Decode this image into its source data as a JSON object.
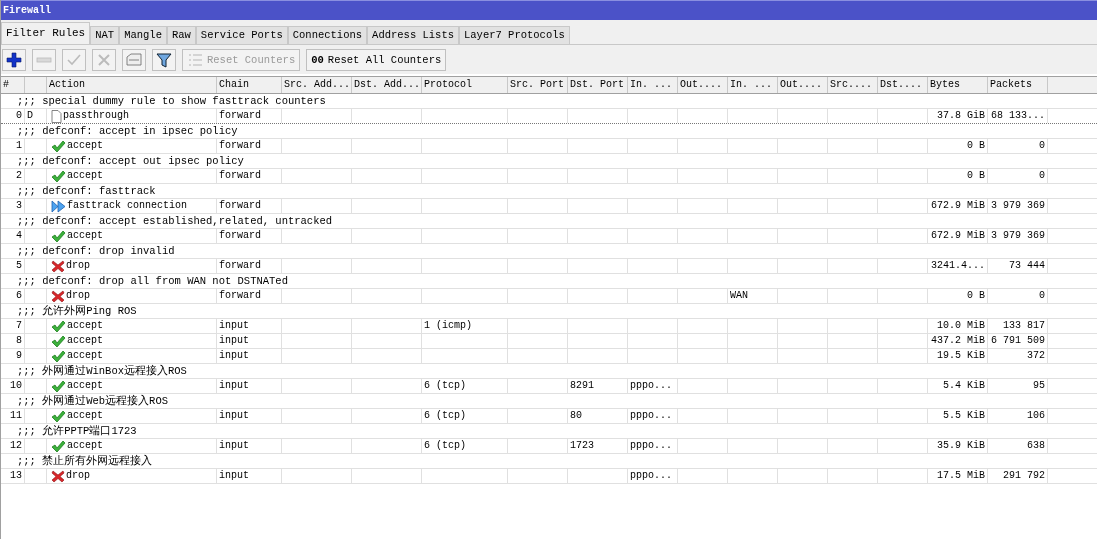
{
  "window": {
    "title": "Firewall"
  },
  "tabs": [
    {
      "label": "Filter Rules",
      "selected": true
    },
    {
      "label": "NAT",
      "selected": false
    },
    {
      "label": "Mangle",
      "selected": false
    },
    {
      "label": "Raw",
      "selected": false
    },
    {
      "label": "Service Ports",
      "selected": false
    },
    {
      "label": "Connections",
      "selected": false
    },
    {
      "label": "Address Lists",
      "selected": false
    },
    {
      "label": "Layer7 Protocols",
      "selected": false
    }
  ],
  "toolbar": [
    {
      "kind": "add",
      "disabled": false
    },
    {
      "kind": "remove",
      "disabled": true
    },
    {
      "kind": "enable",
      "disabled": true
    },
    {
      "kind": "disable",
      "disabled": true
    },
    {
      "kind": "comment",
      "disabled": false
    },
    {
      "kind": "filter",
      "disabled": false
    },
    {
      "kind": "reset",
      "label": "Reset Counters",
      "disabled": true
    },
    {
      "kind": "reset_all",
      "label": "Reset All Counters",
      "prefix": "00",
      "disabled": false
    }
  ],
  "table": {
    "columns": [
      "#",
      "",
      "Action",
      "Chain",
      "Src. Add...",
      "Dst. Add...",
      "Protocol",
      "Src. Port",
      "Dst. Port",
      "In. ...",
      "Out....",
      "In. ...",
      "Out....",
      "Src....",
      "Dst....",
      "Bytes",
      "Packets"
    ],
    "rows": [
      {
        "kind": "comment",
        "text": ";;; special dummy rule to show fasttrack counters"
      },
      {
        "kind": "rule",
        "focused": true,
        "number": "0",
        "flag": "D",
        "action": {
          "kind": "passthrough",
          "label": "passthrough"
        },
        "chain": "forward",
        "bytes": "37.8 GiB",
        "packets": "68 133..."
      },
      {
        "kind": "comment",
        "text": ";;; defconf: accept in ipsec policy"
      },
      {
        "kind": "rule",
        "focused": false,
        "number": "1",
        "action": {
          "kind": "accept",
          "label": "accept"
        },
        "chain": "forward",
        "bytes": "0 B",
        "packets": "0"
      },
      {
        "kind": "comment",
        "text": ";;; defconf: accept out ipsec policy"
      },
      {
        "kind": "rule",
        "focused": false,
        "number": "2",
        "action": {
          "kind": "accept",
          "label": "accept"
        },
        "chain": "forward",
        "bytes": "0 B",
        "packets": "0"
      },
      {
        "kind": "comment",
        "text": ";;; defconf: fasttrack"
      },
      {
        "kind": "rule",
        "focused": false,
        "number": "3",
        "action": {
          "kind": "fasttrack",
          "label": "fasttrack connection"
        },
        "chain": "forward",
        "bytes": "672.9 MiB",
        "packets": "3 979 369"
      },
      {
        "kind": "comment",
        "text": ";;; defconf: accept established,related, untracked"
      },
      {
        "kind": "rule",
        "focused": false,
        "number": "4",
        "action": {
          "kind": "accept",
          "label": "accept"
        },
        "chain": "forward",
        "bytes": "672.9 MiB",
        "packets": "3 979 369"
      },
      {
        "kind": "comment",
        "text": ";;; defconf: drop invalid"
      },
      {
        "kind": "rule",
        "focused": false,
        "number": "5",
        "action": {
          "kind": "drop",
          "label": "drop"
        },
        "chain": "forward",
        "bytes": "3241.4...",
        "packets": "73 444"
      },
      {
        "kind": "comment",
        "text": ";;; defconf:  drop all from WAN not DSTNATed"
      },
      {
        "kind": "rule",
        "focused": false,
        "number": "6",
        "action": {
          "kind": "drop",
          "label": "drop"
        },
        "chain": "forward",
        "in_2": "WAN",
        "bytes": "0 B",
        "packets": "0"
      },
      {
        "kind": "comment",
        "text": ";;; 允许外网Ping ROS"
      },
      {
        "kind": "rule",
        "focused": false,
        "number": "7",
        "action": {
          "kind": "accept",
          "label": "accept"
        },
        "chain": "input",
        "protocol": "1 (icmp)",
        "bytes": "10.0 MiB",
        "packets": "133 817"
      },
      {
        "kind": "rule",
        "focused": false,
        "number": "8",
        "action": {
          "kind": "accept",
          "label": "accept"
        },
        "chain": "input",
        "bytes": "437.2 MiB",
        "packets": "6 791 509"
      },
      {
        "kind": "rule",
        "focused": false,
        "number": "9",
        "action": {
          "kind": "accept",
          "label": "accept"
        },
        "chain": "input",
        "bytes": "19.5 KiB",
        "packets": "372"
      },
      {
        "kind": "comment",
        "text": ";;; 外网通过WinBox远程接入ROS"
      },
      {
        "kind": "rule",
        "focused": false,
        "number": "10",
        "action": {
          "kind": "accept",
          "label": "accept"
        },
        "chain": "input",
        "protocol": "6 (tcp)",
        "dst_port": "8291",
        "in_1": "pppo...",
        "bytes": "5.4 KiB",
        "packets": "95"
      },
      {
        "kind": "comment",
        "text": ";;; 外网通过Web远程接入ROS"
      },
      {
        "kind": "rule",
        "focused": false,
        "number": "11",
        "action": {
          "kind": "accept",
          "label": "accept"
        },
        "chain": "input",
        "protocol": "6 (tcp)",
        "dst_port": "80",
        "in_1": "pppo...",
        "bytes": "5.5 KiB",
        "packets": "106"
      },
      {
        "kind": "comment",
        "text": ";;; 允许PPTP端口1723"
      },
      {
        "kind": "rule",
        "focused": false,
        "number": "12",
        "action": {
          "kind": "accept",
          "label": "accept"
        },
        "chain": "input",
        "protocol": "6 (tcp)",
        "dst_port": "1723",
        "in_1": "pppo...",
        "bytes": "35.9 KiB",
        "packets": "638"
      },
      {
        "kind": "comment",
        "text": ";;; 禁止所有外网远程接入"
      },
      {
        "kind": "rule",
        "focused": false,
        "number": "13",
        "action": {
          "kind": "drop",
          "label": "drop"
        },
        "chain": "input",
        "in_1": "pppo...",
        "bytes": "17.5 MiB",
        "packets": "291 792"
      }
    ]
  }
}
